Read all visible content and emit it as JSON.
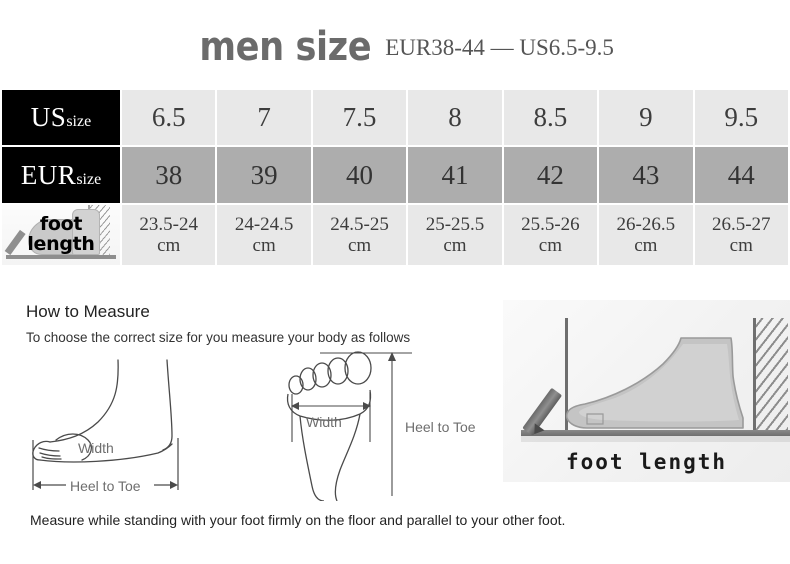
{
  "header": {
    "title": "men size",
    "subtitle": "EUR38-44 — US6.5-9.5"
  },
  "table": {
    "rows": [
      {
        "key": "us",
        "label_main": "US",
        "label_sub": "size",
        "values": [
          "6.5",
          "7",
          "7.5",
          "8",
          "8.5",
          "9",
          "9.5"
        ]
      },
      {
        "key": "eur",
        "label_main": "EUR",
        "label_sub": "size",
        "values": [
          "38",
          "39",
          "40",
          "41",
          "42",
          "43",
          "44"
        ]
      },
      {
        "key": "foot_length",
        "label_line1": "foot",
        "label_line2": "length",
        "values_line1": [
          "23.5-24",
          "24-24.5",
          "24.5-25",
          "25-25.5",
          "25.5-26",
          "26-26.5",
          "26.5-27"
        ],
        "unit": "cm"
      }
    ]
  },
  "how_to_measure": {
    "title": "How to Measure",
    "subtitle": "To choose the correct size for you measure your body as follows",
    "footer": "Measure while standing with your foot firmly on the floor and parallel to your other foot.",
    "diagram_side": {
      "width_label": "Width",
      "heel_to_toe_label": "Heel to Toe"
    },
    "diagram_sole": {
      "width_label": "Width",
      "heel_to_toe_label": "Heel to Toe"
    },
    "photo": {
      "caption": "foot length"
    }
  },
  "colors": {
    "header_cell_bg": "#000000",
    "row_us_bg": "#e8e8e8",
    "row_eur_bg": "#adadad",
    "row_foot_bg": "#e8e8e8",
    "title_color": "#6b6b6b",
    "page_bg": "#ffffff"
  }
}
